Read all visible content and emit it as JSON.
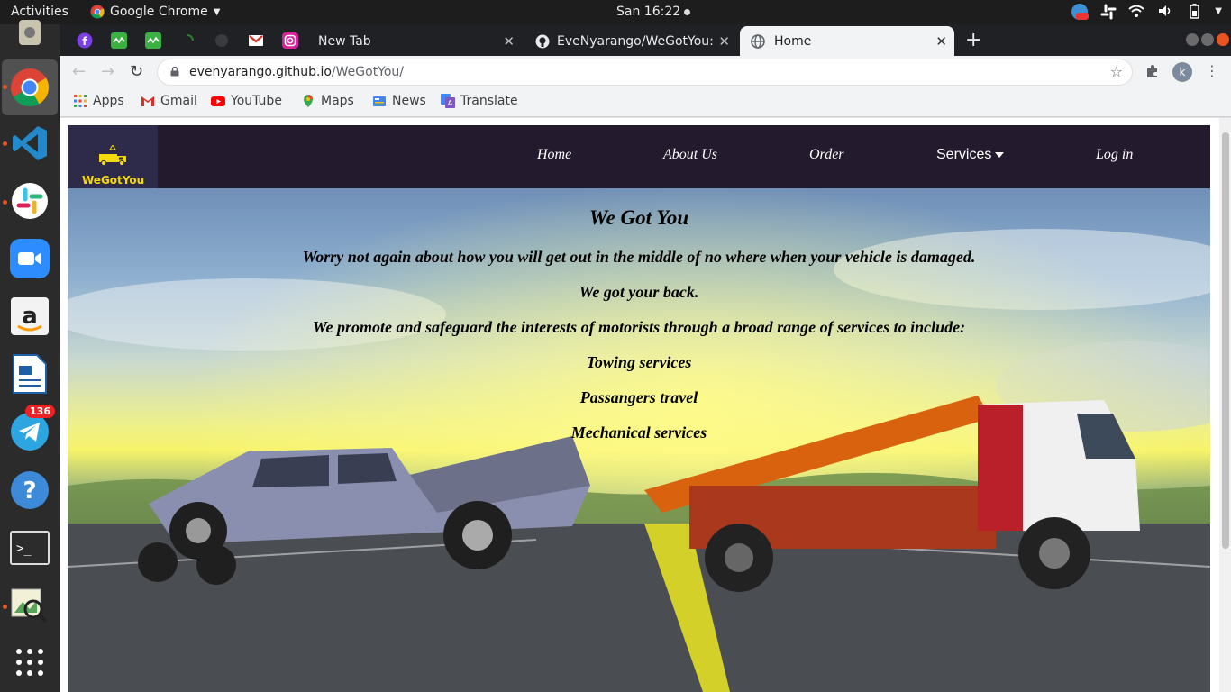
{
  "system": {
    "activities": "Activities",
    "app_name": "Google Chrome",
    "clock": "San 16:22",
    "tray_badge": "136"
  },
  "dock": {
    "telegram_badge": "136"
  },
  "browser": {
    "tabs": [
      {
        "label": "New Tab"
      },
      {
        "label": "EveNyarango/WeGotYou:"
      },
      {
        "label": "Home"
      }
    ],
    "url_host": "evenyarango.github.io",
    "url_path": "/WeGotYou/",
    "profile_initial": "k",
    "bookmarks": [
      "Apps",
      "Gmail",
      "YouTube",
      "Maps",
      "News",
      "Translate"
    ]
  },
  "site": {
    "logo_text": "WeGotYou",
    "nav": {
      "home": "Home",
      "about": "About Us",
      "order": "Order",
      "services": "Services",
      "login": "Log in"
    },
    "hero": {
      "title": "We Got You",
      "line1": "Worry not again about how you will get out in the middle of no where when your vehicle is damaged.",
      "line2": "We got your back.",
      "line3": "We promote and safeguard the interests of motorists through a broad range of services to include:",
      "service1": "Towing services",
      "service2": "Passangers travel",
      "service3": "Mechanical services"
    }
  },
  "colors": {
    "site_nav_bg": "#231a2e",
    "logo_yellow": "#f5d90a"
  }
}
